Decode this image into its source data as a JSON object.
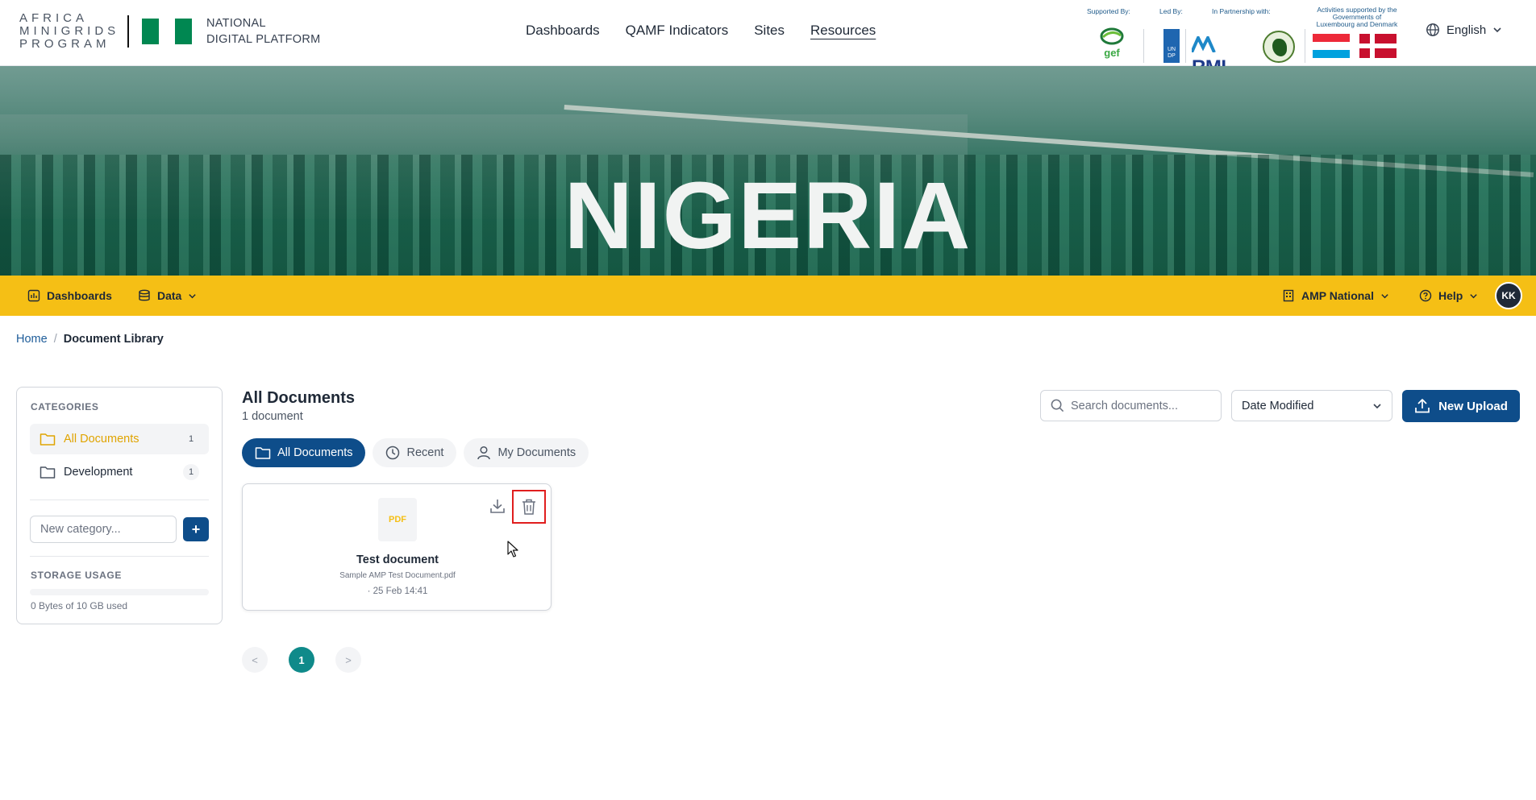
{
  "header": {
    "logo_lines": [
      "AFRICA",
      "MINIGRIDS",
      "PROGRAM"
    ],
    "platform_name_line1": "NATIONAL",
    "platform_name_line2": "DIGITAL PLATFORM",
    "nav": [
      {
        "label": "Dashboards"
      },
      {
        "label": "QAMF Indicators"
      },
      {
        "label": "Sites"
      },
      {
        "label": "Resources",
        "active": true
      }
    ],
    "partners": {
      "supported_by": "Supported By:",
      "led_by": "Led By:",
      "in_partnership": "In Partnership with:",
      "activities_line1": "Activities supported by the",
      "activities_line2": "Governments of",
      "activities_line3": "Luxembourg and Denmark",
      "gef": "gef",
      "undp": "UN DP",
      "rmi": "RMI"
    },
    "language": "English"
  },
  "hero": {
    "title": "NIGERIA"
  },
  "subnav": {
    "dashboards": "Dashboards",
    "data": "Data",
    "org": "AMP National",
    "help": "Help",
    "avatar_initials": "KK"
  },
  "breadcrumb": {
    "home": "Home",
    "separator": "/",
    "current": "Document Library"
  },
  "sidebar": {
    "categories_title": "CATEGORIES",
    "categories": [
      {
        "name": "All Documents",
        "count": "1",
        "active": true
      },
      {
        "name": "Development",
        "count": "1"
      }
    ],
    "new_category_placeholder": "New category...",
    "add_label": "+",
    "storage_title": "STORAGE USAGE",
    "storage_used_fraction": 0,
    "storage_text": "0 Bytes of 10 GB used"
  },
  "main": {
    "title": "All Documents",
    "count_text": "1 document",
    "search_placeholder": "Search documents...",
    "sort_value": "Date Modified",
    "upload_label": "New Upload",
    "tabs": [
      {
        "label": "All Documents",
        "active": true
      },
      {
        "label": "Recent"
      },
      {
        "label": "My Documents"
      }
    ],
    "documents": [
      {
        "type_badge": "PDF",
        "name": "Test document",
        "file": "Sample AMP Test Document.pdf",
        "date": "· 25 Feb 14:41"
      }
    ],
    "pagination": {
      "prev": "<",
      "current": "1",
      "next": ">"
    }
  },
  "colors": {
    "brand_blue": "#0e4d8a",
    "accent_yellow": "#f5bf15",
    "teal": "#0f8a8a",
    "delete_highlight": "#e01e1e"
  }
}
